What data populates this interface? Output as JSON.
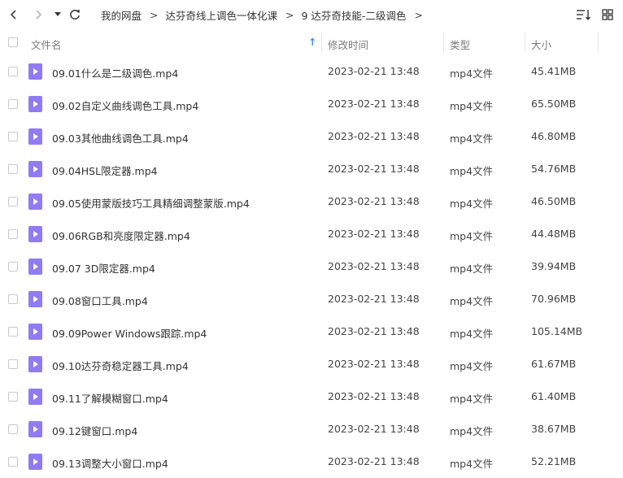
{
  "toolbar": {
    "back_icon": "chevron-left-icon",
    "forward_icon": "chevron-right-icon",
    "history_icon": "caret-down-icon",
    "refresh_icon": "refresh-icon",
    "sort_icon": "sort-list-icon",
    "grid_icon": "grid-view-icon"
  },
  "breadcrumb": [
    "我的网盘",
    "达芬奇线上调色一体化课",
    "9 达芬奇技能-二级调色"
  ],
  "breadcrumb_separator": ">",
  "columns": {
    "name": "文件名",
    "date": "修改时间",
    "type": "类型",
    "size": "大小",
    "sort_indicator": "↑"
  },
  "colors": {
    "accent": "#3d8bf5",
    "file_icon": "#8f7cf3"
  },
  "files": [
    {
      "name": "09.01什么是二级调色.mp4",
      "date": "2023-02-21 13:48",
      "type": "mp4文件",
      "size": "45.41MB"
    },
    {
      "name": "09.02自定义曲线调色工具.mp4",
      "date": "2023-02-21 13:48",
      "type": "mp4文件",
      "size": "65.50MB"
    },
    {
      "name": "09.03其他曲线调色工具.mp4",
      "date": "2023-02-21 13:48",
      "type": "mp4文件",
      "size": "46.80MB"
    },
    {
      "name": "09.04HSL限定器.mp4",
      "date": "2023-02-21 13:48",
      "type": "mp4文件",
      "size": "54.76MB"
    },
    {
      "name": "09.05使用蒙版技巧工具精细调整蒙版.mp4",
      "date": "2023-02-21 13:48",
      "type": "mp4文件",
      "size": "46.50MB"
    },
    {
      "name": "09.06RGB和亮度限定器.mp4",
      "date": "2023-02-21 13:48",
      "type": "mp4文件",
      "size": "44.48MB"
    },
    {
      "name": "09.07 3D限定器.mp4",
      "date": "2023-02-21 13:48",
      "type": "mp4文件",
      "size": "39.94MB"
    },
    {
      "name": "09.08窗口工具.mp4",
      "date": "2023-02-21 13:48",
      "type": "mp4文件",
      "size": "70.96MB"
    },
    {
      "name": "09.09Power Windows跟踪.mp4",
      "date": "2023-02-21 13:48",
      "type": "mp4文件",
      "size": "105.14MB"
    },
    {
      "name": "09.10达芬奇稳定器工具.mp4",
      "date": "2023-02-21 13:48",
      "type": "mp4文件",
      "size": "61.67MB"
    },
    {
      "name": "09.11了解模糊窗口.mp4",
      "date": "2023-02-21 13:48",
      "type": "mp4文件",
      "size": "61.40MB"
    },
    {
      "name": "09.12键窗口.mp4",
      "date": "2023-02-21 13:48",
      "type": "mp4文件",
      "size": "38.67MB"
    },
    {
      "name": "09.13调整大小窗口.mp4",
      "date": "2023-02-21 13:48",
      "type": "mp4文件",
      "size": "52.21MB"
    }
  ]
}
